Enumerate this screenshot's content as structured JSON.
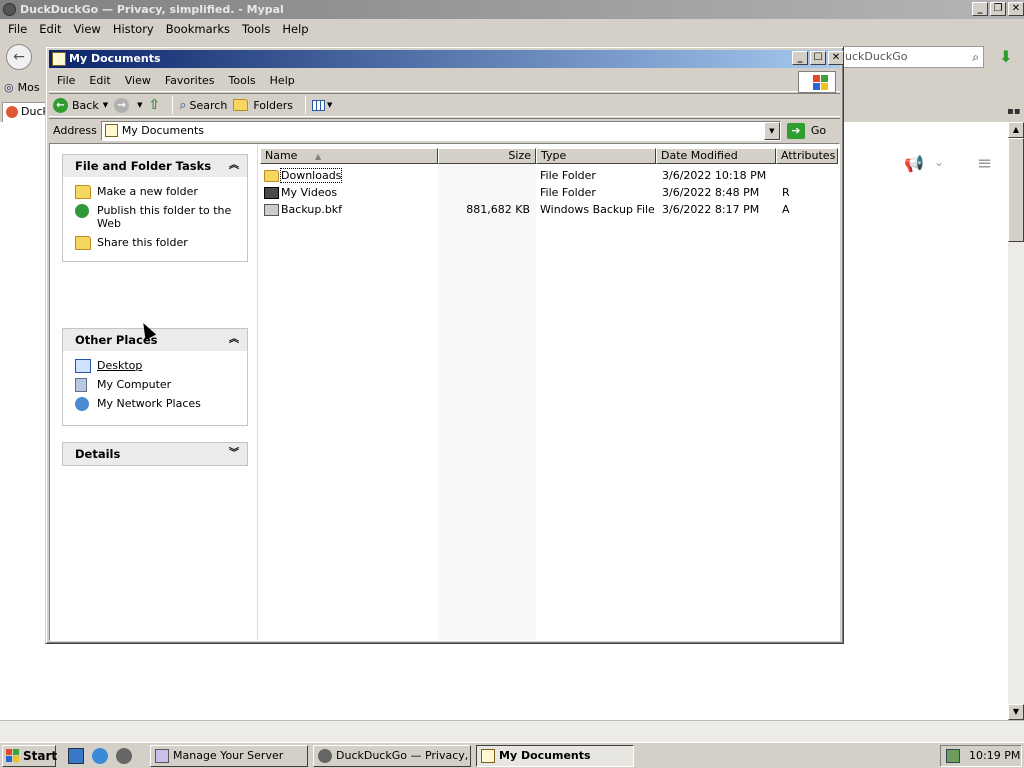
{
  "browser": {
    "title": "DuckDuckGo — Privacy, simplified. - Mypal",
    "menu": [
      "File",
      "Edit",
      "View",
      "History",
      "Bookmarks",
      "Tools",
      "Help"
    ],
    "search_text": "uckDuckGo",
    "bookmark_partial": "Mos",
    "tab_partial": "Duck"
  },
  "explorer": {
    "title": "My Documents",
    "menu": [
      "File",
      "Edit",
      "View",
      "Favorites",
      "Tools",
      "Help"
    ],
    "toolbar": {
      "back": "Back",
      "search": "Search",
      "folders": "Folders"
    },
    "address": {
      "label": "Address",
      "value": "My Documents",
      "go": "Go"
    },
    "panels": {
      "tasks": {
        "title": "File and Folder Tasks",
        "items": [
          "Make a new folder",
          "Publish this folder to the Web",
          "Share this folder"
        ]
      },
      "other": {
        "title": "Other Places",
        "items": [
          "Desktop",
          "My Computer",
          "My Network Places"
        ]
      },
      "details": {
        "title": "Details"
      }
    },
    "columns": [
      "Name",
      "Size",
      "Type",
      "Date Modified",
      "Attributes"
    ],
    "files": [
      {
        "name": "Downloads",
        "size": "",
        "type": "File Folder",
        "date": "3/6/2022 10:18 PM",
        "attr": "",
        "icon": "folder-icon"
      },
      {
        "name": "My Videos",
        "size": "",
        "type": "File Folder",
        "date": "3/6/2022 8:48 PM",
        "attr": "R",
        "icon": "video-folder-icon"
      },
      {
        "name": "Backup.bkf",
        "size": "881,682 KB",
        "type": "Windows Backup File",
        "date": "3/6/2022 8:17 PM",
        "attr": "A",
        "icon": "backup-file-icon"
      }
    ]
  },
  "taskbar": {
    "start": "Start",
    "buttons": [
      "Manage Your Server",
      "DuckDuckGo — Privacy, ...",
      "My Documents"
    ],
    "clock": "10:19 PM"
  },
  "colors": {
    "title_active": "#0a246a",
    "title_inactive": "#808080",
    "face": "#d4d0c8"
  }
}
